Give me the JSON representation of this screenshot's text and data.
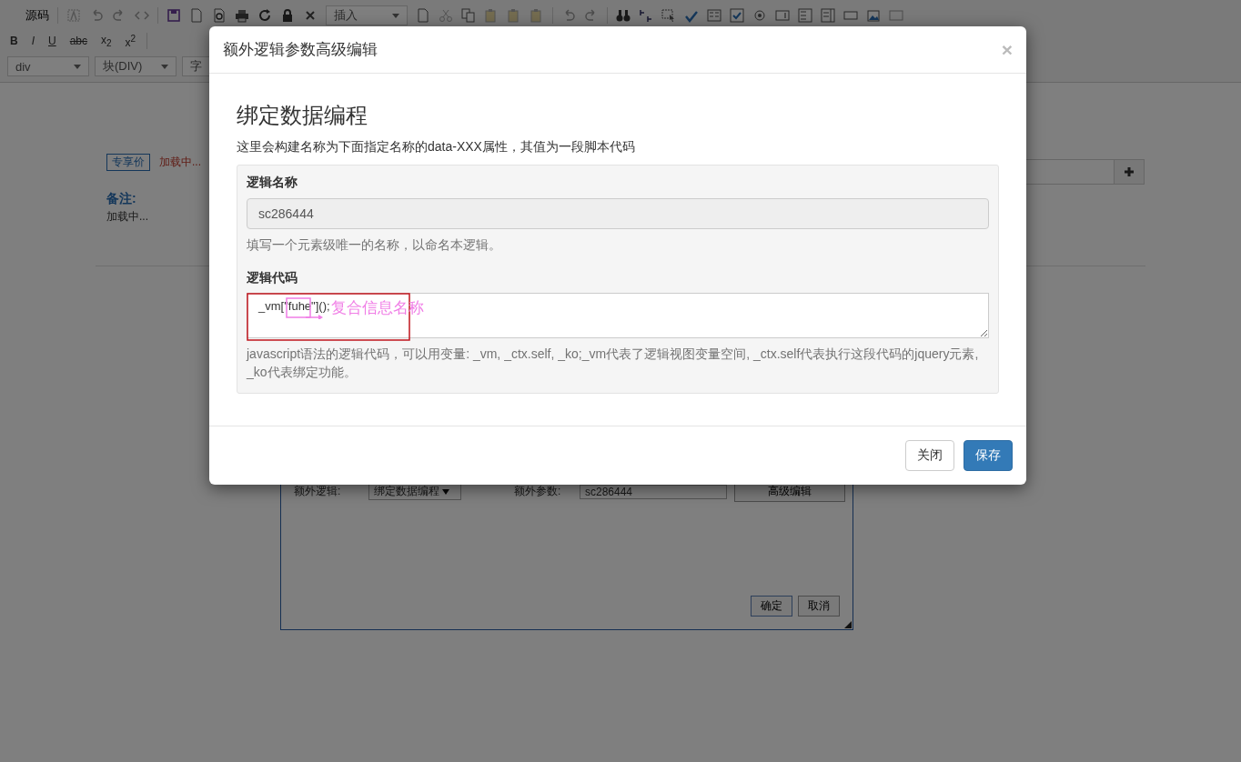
{
  "editor_toolbar": {
    "source_button": "源码",
    "insert_select": "插入",
    "format_buttons": [
      "B",
      "I",
      "U",
      "abc",
      "x$_{2}$",
      "x$^{2}$"
    ],
    "format_select": "div",
    "block_select": "块(DIV)",
    "font_select": "字"
  },
  "page": {
    "tag": "专享价",
    "loading_price": "加载中...",
    "note_label": "备注:",
    "note_text": "加载中..."
  },
  "background_dialog": {
    "logic_label": "额外逻辑:",
    "logic_select": "绑定数据编程",
    "param_label": "额外参数:",
    "param_value": "sc286444",
    "advanced_button": "高级编辑",
    "ok_button": "确定",
    "cancel_button": "取消"
  },
  "modal": {
    "title": "额外逻辑参数高级编辑",
    "close": "×",
    "heading": "绑定数据编程",
    "description": "这里会构建名称为下面指定名称的data-XXX属性，其值为一段脚本代码",
    "name_field": {
      "label": "逻辑名称",
      "value": "sc286444",
      "disabled": true,
      "help": "填写一个元素级唯一的名称，以命名本逻辑。"
    },
    "code_field": {
      "label": "逻辑代码",
      "value": "_vm[\"fuhe\"]();",
      "help": "javascript语法的逻辑代码，可以用变量: _vm, _ctx.self, _ko;_vm代表了逻辑视图变量空间, _ctx.self代表执行这段代码的jquery元素, _ko代表绑定功能。"
    },
    "buttons": [
      {
        "label": "关闭",
        "kind": "default"
      },
      {
        "label": "保存",
        "kind": "primary"
      }
    ]
  },
  "annotation": {
    "text": "复合信息名称"
  }
}
